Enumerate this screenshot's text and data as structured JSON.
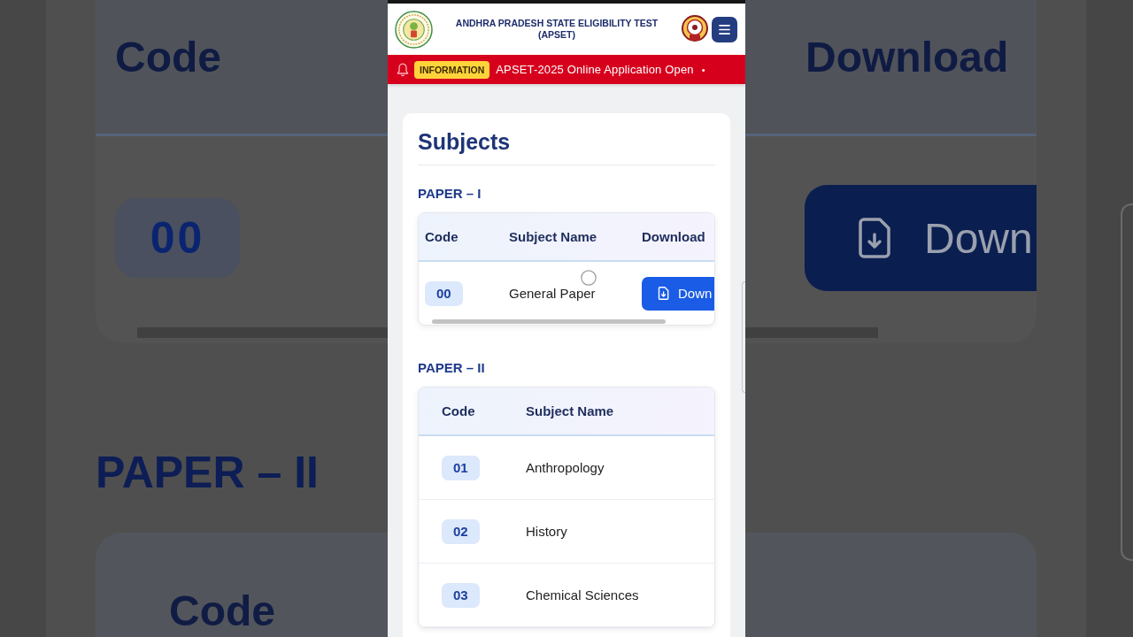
{
  "backdrop": {
    "left": {
      "column_header": "Code",
      "code": "00",
      "section_title": "PAPER – II",
      "column_header_2": "Code"
    },
    "right": {
      "column_header": "Download",
      "button_label": "Down"
    }
  },
  "header": {
    "title": "ANDHRA PRADESH STATE ELIGIBILITY TEST (APSET)"
  },
  "ticker": {
    "badge": "INFORMATION",
    "message": "APSET-2025 Online Application Open",
    "separator": "•"
  },
  "subjects": {
    "title": "Subjects",
    "sections": [
      {
        "title": "PAPER – I",
        "columns": [
          "Code",
          "Subject Name",
          "Download"
        ],
        "rows": [
          {
            "code": "00",
            "name": "General Paper",
            "action": "Down"
          }
        ]
      },
      {
        "title": "PAPER – II",
        "columns": [
          "Code",
          "Subject Name"
        ],
        "rows": [
          {
            "code": "01",
            "name": "Anthropology"
          },
          {
            "code": "02",
            "name": "History"
          },
          {
            "code": "03",
            "name": "Chemical Sciences"
          }
        ]
      }
    ]
  }
}
